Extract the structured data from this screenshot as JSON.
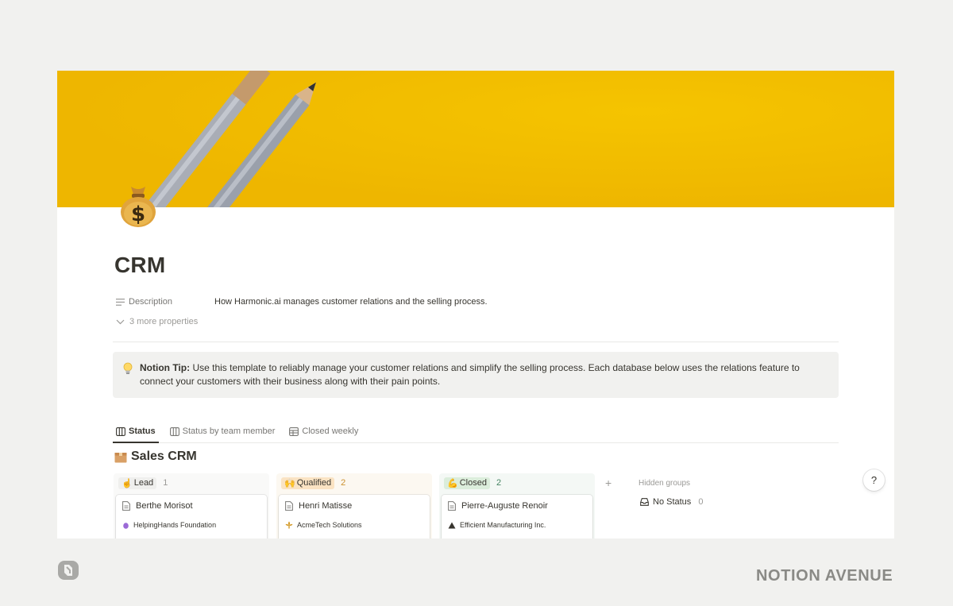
{
  "page": {
    "title": "CRM",
    "icon": "money-bag-icon",
    "cover": "pencils-on-yellow-cover"
  },
  "properties": {
    "description_label": "Description",
    "description_value": "How Harmonic.ai manages customer relations and the selling process.",
    "more_label": "3 more properties"
  },
  "callout": {
    "icon": "lightbulb-icon",
    "bold": "Notion Tip:",
    "text": "Use this template to reliably manage your customer relations and simplify the selling process. Each database below uses the relations feature to",
    "text2": "connect your customers with their business along with their pain points."
  },
  "tabs": [
    {
      "label": "Status",
      "icon": "board-icon"
    },
    {
      "label": "Status by team member",
      "icon": "board-icon"
    },
    {
      "label": "Closed weekly",
      "icon": "table-icon"
    }
  ],
  "database": {
    "icon": "box-icon",
    "title": "Sales CRM"
  },
  "columns": [
    {
      "label": "Lead",
      "emoji": "☝",
      "count": "1",
      "bg": "#f9f9f8",
      "pill_bg": "#efefed",
      "count_color": "#9b9a97",
      "card": {
        "title": "Berthe Morisot",
        "relation": "HelpingHands Foundation",
        "relation_icon": "purple-hand-icon"
      }
    },
    {
      "label": "Qualified",
      "emoji": "🙌",
      "count": "2",
      "bg": "#fcf8f1",
      "pill_bg": "#fae3c3",
      "count_color": "#cb912f",
      "card": {
        "title": "Henri Matisse",
        "relation": "AcmeTech Solutions",
        "relation_icon": "fleur-de-lis-icon"
      }
    },
    {
      "label": "Closed",
      "emoji": "💪",
      "count": "2",
      "bg": "#f4f8f5",
      "pill_bg": "#dbeddb",
      "count_color": "#448361",
      "card": {
        "title": "Pierre-Auguste Renoir",
        "relation": "Efficient Manufacturing Inc.",
        "relation_icon": "triangle-icon"
      }
    }
  ],
  "board": {
    "add_symbol": "+",
    "hidden_groups_label": "Hidden groups",
    "no_status_label": "No Status",
    "no_status_count": "0"
  },
  "help": "?",
  "brand": {
    "name": "NOTION AVENUE",
    "logo": "notion-avenue-logo-icon"
  },
  "colors": {
    "cover": "#f2bd00",
    "background": "#f1f1ef",
    "text": "#37352f"
  }
}
